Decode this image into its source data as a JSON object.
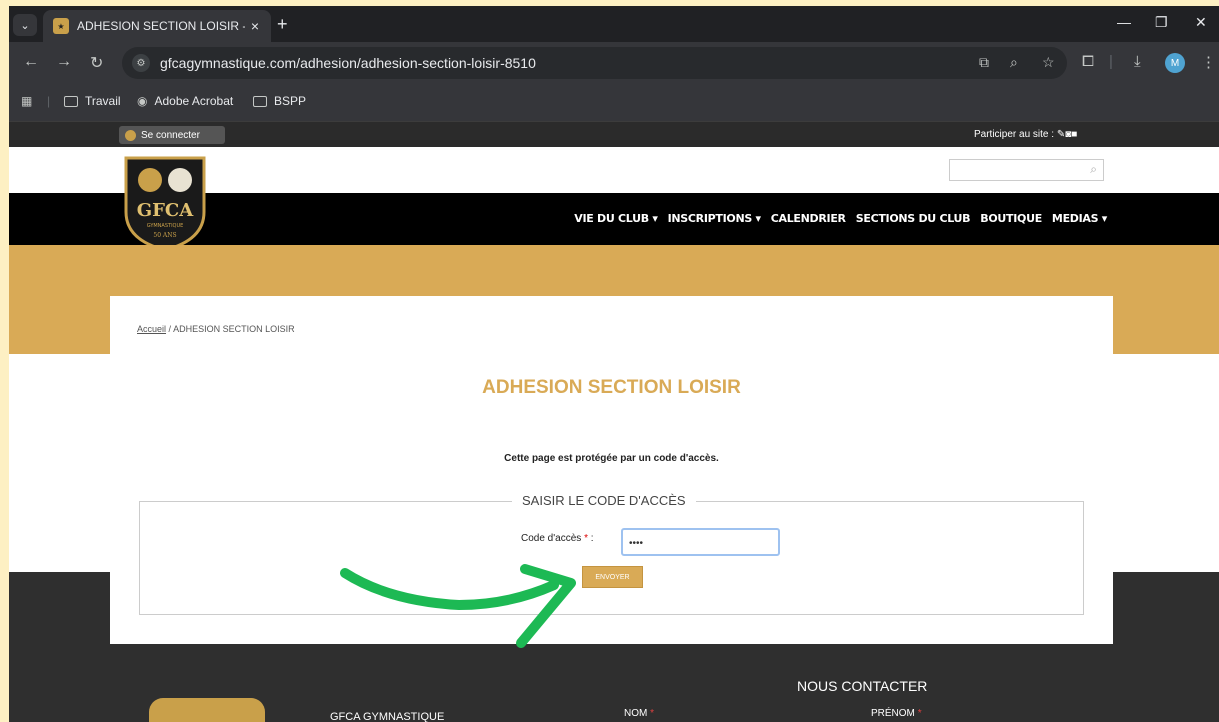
{
  "browser": {
    "tab_title": "ADHESION SECTION LOISIR - G",
    "tab_close": "×",
    "new_tab": "+",
    "url": "gfcagymnastique.com/adhesion/adhesion-section-loisir-8510",
    "avatar_letter": "M",
    "bookmarks": [
      "Travail",
      "Adobe Acrobat",
      "BSPP"
    ]
  },
  "site": {
    "login_label": "Se connecter",
    "participate_label": "Participer au site :",
    "logo_text": "GFCA",
    "logo_sub": "GYMNASTIQUE",
    "logo_years": "50 ANS",
    "nav": [
      "VIE DU CLUB ▾",
      "INSCRIPTIONS ▾",
      "CALENDRIER",
      "SECTIONS DU CLUB",
      "BOUTIQUE",
      "MEDIAS ▾"
    ]
  },
  "page": {
    "breadcrumb_home": "Accueil",
    "breadcrumb_sep": "/",
    "breadcrumb_current": "ADHESION SECTION LOISIR",
    "title": "ADHESION SECTION LOISIR",
    "protected_text": "Cette page est protégée par un code d'accès.",
    "fieldset_legend": "SAISIR LE CODE D'ACCÈS",
    "code_label": "Code d'accès",
    "code_value": "••••",
    "send_label": "ENVOYER"
  },
  "footer": {
    "contact_title": "NOUS CONTACTER",
    "club_name": "GFCA GYMNASTIQUE",
    "nom_label": "NOM",
    "prenom_label": "PRÉNOM"
  },
  "colors": {
    "gold": "#d9aa56",
    "arrow_green": "#1db954",
    "outer_background": "#fdf0c3"
  }
}
